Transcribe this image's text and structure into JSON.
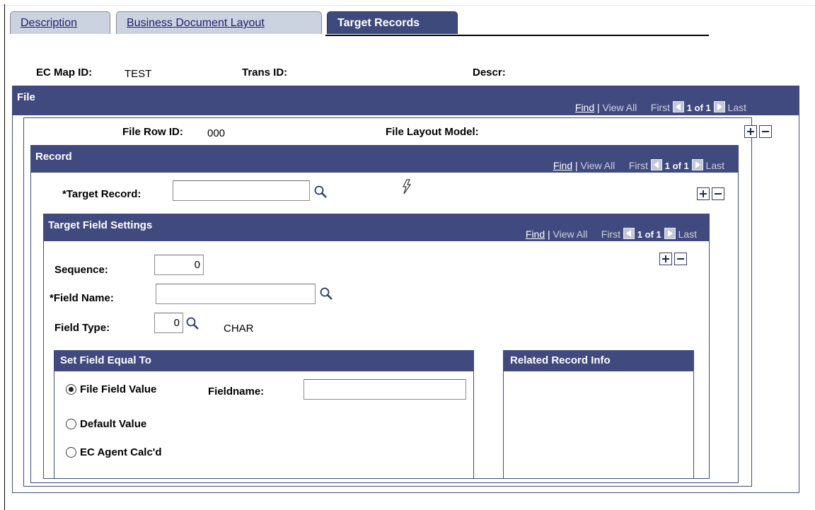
{
  "tabs": [
    {
      "label": "Description"
    },
    {
      "label": "Business Document Layout"
    },
    {
      "label": "Target Records"
    }
  ],
  "header": {
    "ec_map_id_label": "EC Map ID:",
    "ec_map_id_value": "TEST",
    "trans_id_label": "Trans ID:",
    "descr_label": "Descr:"
  },
  "file": {
    "title": "File",
    "nav": {
      "find": "Find",
      "sep": "|",
      "view_all": "View All",
      "first": "First",
      "page": "1 of 1",
      "last": "Last"
    },
    "file_row_id_label": "File Row ID:",
    "file_row_id_value": "000",
    "file_layout_model_label": "File Layout Model:"
  },
  "record": {
    "title": "Record",
    "nav": {
      "find": "Find",
      "sep": "|",
      "view_all": "View All",
      "first": "First",
      "page": "1 of 1",
      "last": "Last"
    },
    "target_record_label": "*Target Record:",
    "target_record_value": ""
  },
  "target_field_settings": {
    "title": "Target Field Settings",
    "nav": {
      "find": "Find",
      "sep": "|",
      "view_all": "View All",
      "first": "First",
      "page": "1 of 1",
      "last": "Last"
    },
    "sequence_label": "Sequence:",
    "sequence_value": "0",
    "field_name_label": "*Field Name:",
    "field_name_value": "",
    "field_type_label": "Field Type:",
    "field_type_value": "0",
    "field_type_desc": "CHAR"
  },
  "set_field_equal_to": {
    "title": "Set Field Equal To",
    "options": [
      {
        "label": "File Field Value",
        "selected": true
      },
      {
        "label": "Default Value",
        "selected": false
      },
      {
        "label": "EC Agent Calc'd",
        "selected": false
      }
    ],
    "fieldname_label": "Fieldname:",
    "fieldname_value": ""
  },
  "related_record_info": {
    "title": "Related Record Info"
  },
  "icons": {
    "lookup": "magnifier-icon",
    "prompt": "lightning-icon",
    "add_row": "plus-icon",
    "delete_row": "minus-icon",
    "prev": "left-arrow-icon",
    "next": "right-arrow-icon"
  },
  "colors": {
    "header_bg": "#414a7f",
    "tab_active_bg": "#3f4a7c",
    "tab_inactive_bg": "#ccd3e0"
  }
}
